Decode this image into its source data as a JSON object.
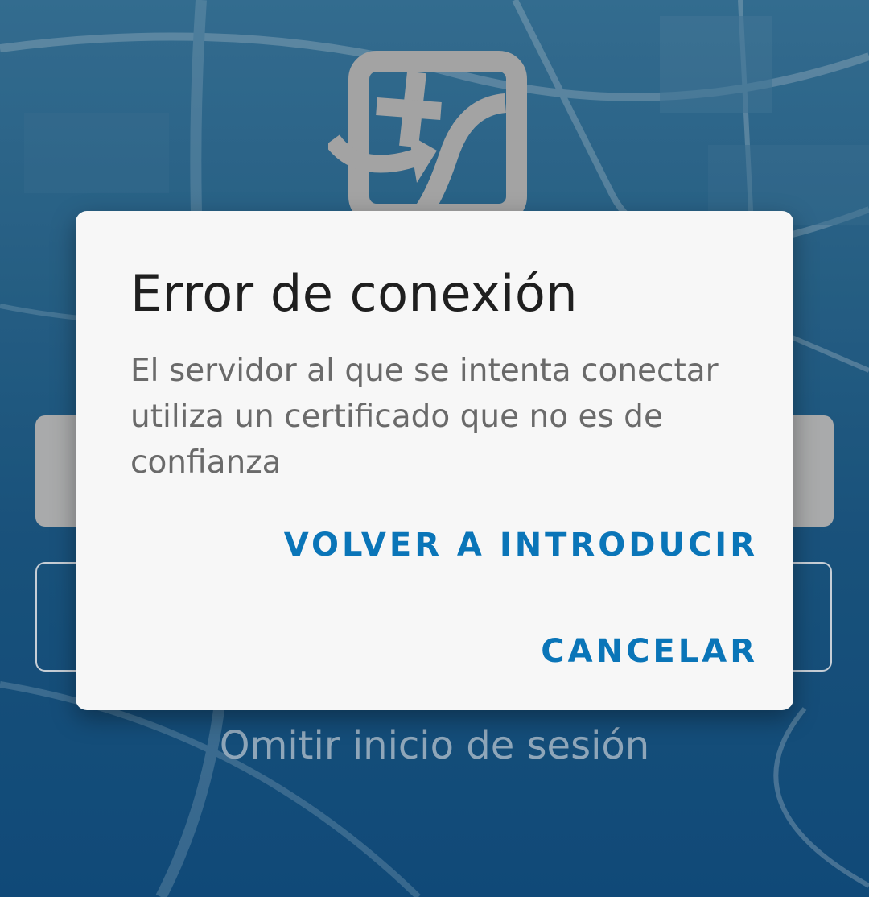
{
  "dialog": {
    "title": "Error de conexión",
    "message": "El servidor al que se intenta conectar utiliza un certificado que no es de confianza",
    "reenter_label": "VOLVER A INTRODUCIR",
    "cancel_label": "CANCELAR"
  },
  "background": {
    "skip_label": "Omitir inicio de sesión"
  },
  "colors": {
    "accent": "#0a75b8",
    "dialog_bg": "#f7f7f7",
    "background_blue": "#1f5f8e"
  },
  "icons": {
    "app_logo": "app-logo-icon"
  }
}
